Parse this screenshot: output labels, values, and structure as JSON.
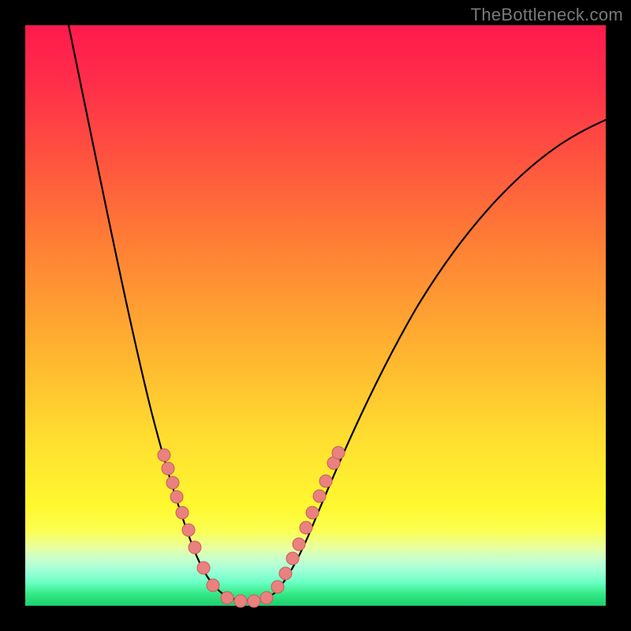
{
  "watermark": "TheBottleneck.com",
  "colors": {
    "frame_border": "#000000",
    "gradient_top": "#ff1a4d",
    "gradient_mid": "#ffe030",
    "gradient_bottom": "#1dcf6e",
    "curve_stroke": "#000000",
    "dot_fill": "#e9817e",
    "dot_stroke": "#c85d5a",
    "watermark_text": "#7a7a7a"
  },
  "chart_data": {
    "type": "line",
    "title": "",
    "xlabel": "",
    "ylabel": "",
    "xlim": [
      0,
      100
    ],
    "ylim": [
      0,
      100
    ],
    "description": "V-shaped bottleneck curve over a red→yellow→green vertical gradient. Minimum (≈0% bottleneck) near x≈37. Curve rises steeply to the left reaching 100% near x≈7 and rises with decreasing slope to the right toward ≈84% at x=100.",
    "series": [
      {
        "name": "bottleneck-curve",
        "x": [
          7,
          12,
          16,
          20,
          24,
          28,
          30,
          32,
          34,
          36,
          37,
          39,
          41,
          43,
          46,
          50,
          55,
          60,
          68,
          78,
          88,
          100
        ],
        "y": [
          100,
          78,
          62,
          48,
          36,
          24,
          17,
          11,
          6,
          2,
          0.5,
          0.5,
          2,
          5,
          10,
          18,
          28,
          38,
          51,
          64,
          74,
          84
        ]
      },
      {
        "name": "highlighted-points",
        "x": [
          24,
          24.7,
          25.5,
          26.2,
          27.2,
          28.2,
          29.3,
          30.8,
          32.5,
          34.8,
          37,
          39.4,
          41.5,
          43.5,
          44.8,
          46.1,
          47.2,
          48.4,
          49.5,
          50.7,
          52.0,
          53.1,
          53.9
        ],
        "y": [
          26,
          23.5,
          21,
          18.5,
          15.8,
          12.8,
          9.8,
          6.3,
          3.2,
          1.0,
          0.5,
          1.0,
          3.1,
          5.5,
          8.1,
          10.8,
          13.3,
          16.0,
          18.8,
          21.4,
          24.6,
          26.4,
          28.0
        ]
      }
    ],
    "legend": false,
    "grid": false
  }
}
